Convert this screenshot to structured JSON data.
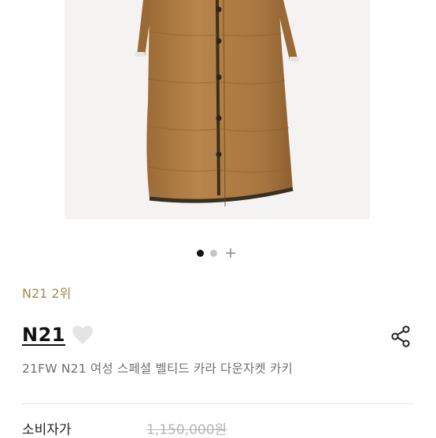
{
  "gallery": {
    "image_alt": "N21 coat product photo",
    "slide_count_visible": 2,
    "active_slide": 1,
    "more_icon": "plus-icon"
  },
  "brand": {
    "ranking": "N21 2위",
    "name": "N21",
    "wish_icon": "heart-icon",
    "share_icon": "share-icon"
  },
  "product": {
    "name": "21FW N21 여성 스페셜 벨티드 카라 다운자켓 카키"
  },
  "price": {
    "label": "소비자가",
    "value": "1,150,000원"
  },
  "colors": {
    "brand_rank": "#a08b52",
    "coat": "#b07d44",
    "trim": "#3b2f1e"
  }
}
